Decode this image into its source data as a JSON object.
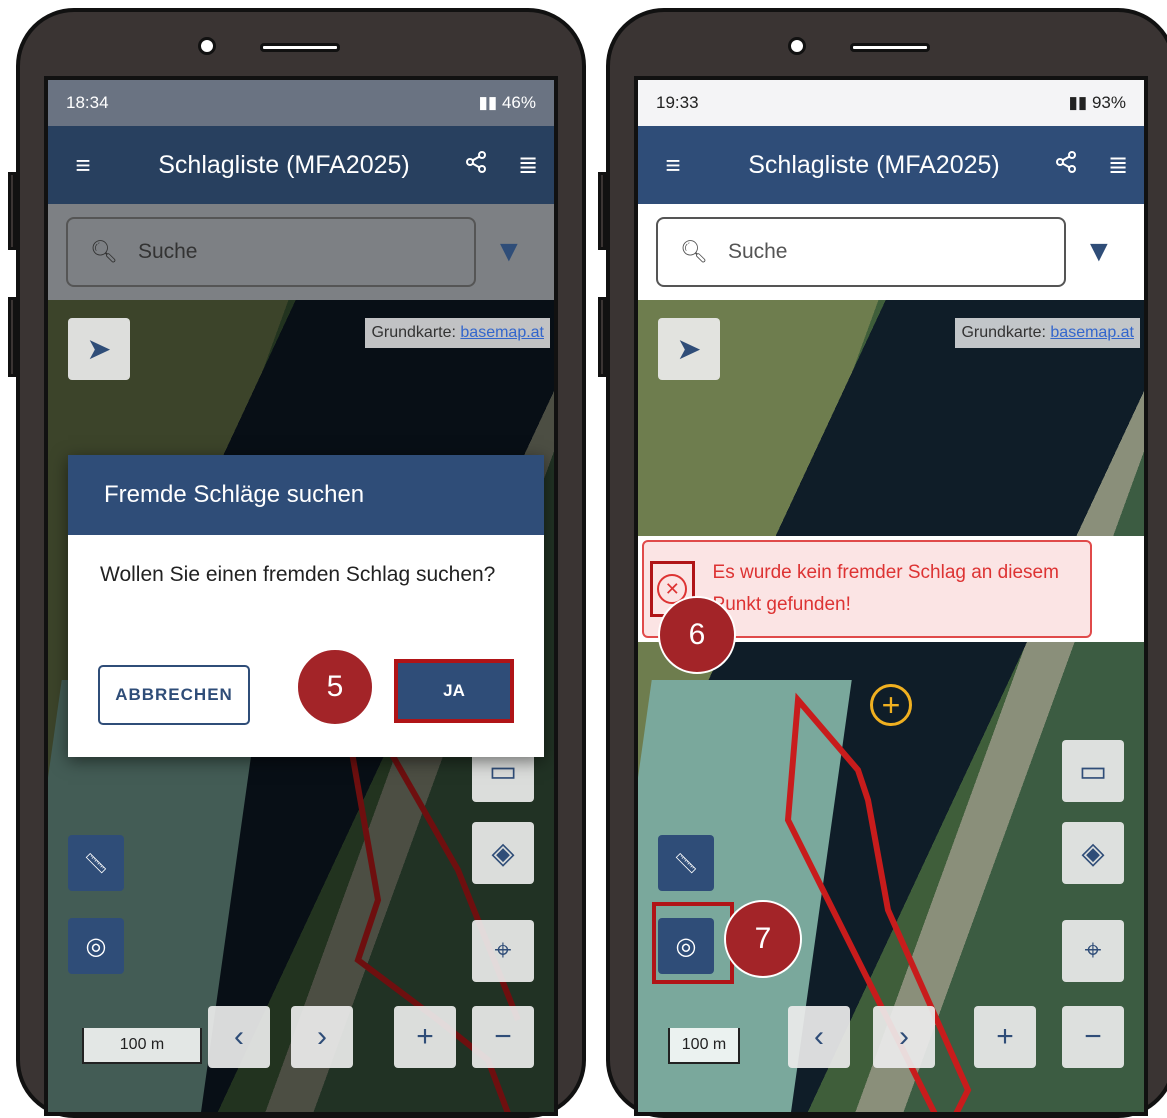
{
  "left_phone": {
    "status": {
      "time": "18:34",
      "battery": "46%"
    },
    "appbar": {
      "menu_icon": "≡",
      "title": "Schlagliste (MFA2025)",
      "share_icon": "share-icon",
      "list_icon": "≣"
    },
    "search": {
      "placeholder": "Suche"
    },
    "map": {
      "attribution_label": "Grundkarte:",
      "attribution_link": "basemap.at",
      "scale": "100 m"
    },
    "dialog": {
      "title": "Fremde Schläge suchen",
      "message": "Wollen Sie einen fremden Schlag suchen?",
      "cancel_label": "ABBRECHEN",
      "ok_label": "JA"
    },
    "step_marker": "5"
  },
  "right_phone": {
    "status": {
      "time": "19:33",
      "battery": "93%"
    },
    "appbar": {
      "menu_icon": "≡",
      "title": "Schlagliste (MFA2025)",
      "share_icon": "share-icon",
      "list_icon": "≣"
    },
    "search": {
      "placeholder": "Suche"
    },
    "map": {
      "attribution_label": "Grundkarte:",
      "attribution_link": "basemap.at",
      "scale": "100 m"
    },
    "toast": {
      "message": "Es wurde kein fremder Schlag an diesem Punkt gefunden!"
    },
    "step_markers": [
      "6",
      "7"
    ]
  },
  "colors": {
    "primary": "#2f4d78",
    "highlight": "#b01417",
    "marker": "#a32428",
    "error": "#d33333"
  }
}
